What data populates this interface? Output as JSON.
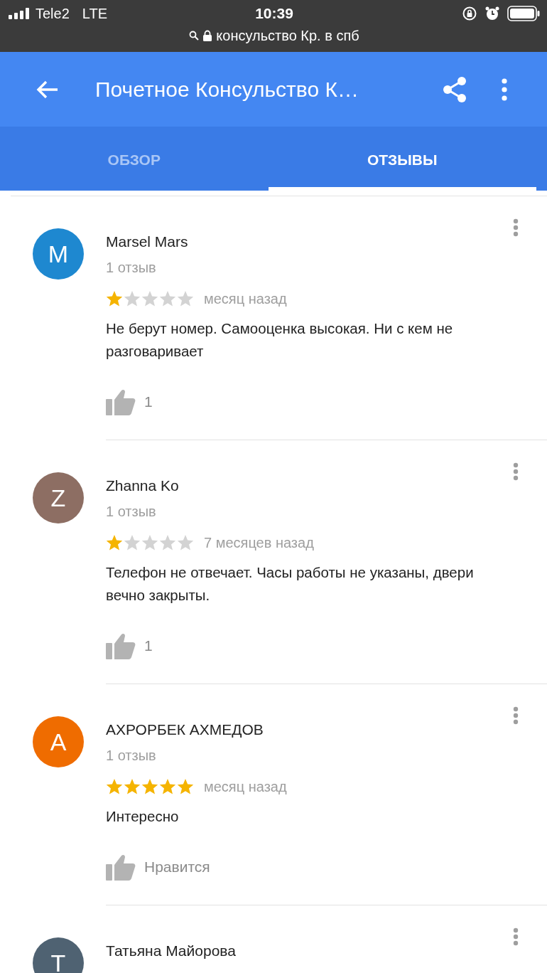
{
  "status_bar": {
    "carrier": "Tele2",
    "network": "LTE",
    "time": "10:39",
    "url": "консульство Кр. в спб"
  },
  "app_bar": {
    "title": "Почетное Консульство К…"
  },
  "tabs": [
    {
      "label": "ОБЗОР",
      "selected": false
    },
    {
      "label": "ОТЗЫВЫ",
      "selected": true
    }
  ],
  "reviews": [
    {
      "initial": "M",
      "color": "#1e88d0",
      "name": "Marsel Mars",
      "count": "1 отзыв",
      "stars": 1,
      "time": "месяц назад",
      "text": "Не берут номер. Самооценка высокая. Ни с кем не разговаривает",
      "likes": "1"
    },
    {
      "initial": "Z",
      "color": "#8d6e63",
      "name": "Zhanna Ko",
      "count": "1 отзыв",
      "stars": 1,
      "time": "7 месяцев назад",
      "text": "Телефон не отвечает. Часы работы не указаны, двери вечно закрыты.",
      "likes": "1"
    },
    {
      "initial": "A",
      "color": "#ef6c00",
      "name": "АХРОРБЕК АХМЕДОВ",
      "count": "1 отзыв",
      "stars": 5,
      "time": "месяц назад",
      "text": "Интересно",
      "likes": "Нравится"
    },
    {
      "initial": "T",
      "color": "#4f6272",
      "name": "Татьяна Майорова"
    }
  ]
}
